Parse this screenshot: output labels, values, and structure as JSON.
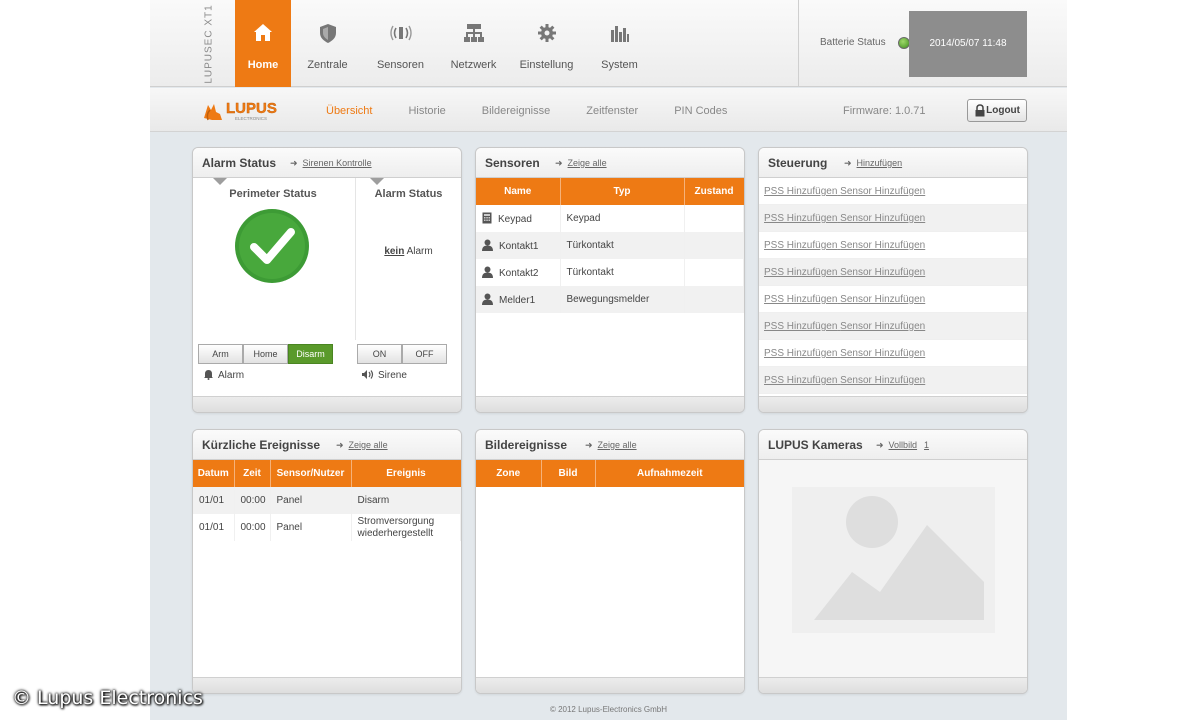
{
  "topbar": {
    "brand": "LUPUSEC XT1",
    "nav": [
      {
        "label": "Home",
        "icon": "home-icon",
        "active": true
      },
      {
        "label": "Zentrale",
        "icon": "shield-icon"
      },
      {
        "label": "Sensoren",
        "icon": "sensor-icon"
      },
      {
        "label": "Netzwerk",
        "icon": "network-icon"
      },
      {
        "label": "Einstellung",
        "icon": "gear-icon"
      },
      {
        "label": "System",
        "icon": "system-icon"
      }
    ],
    "battery_label": "Batterie Status",
    "datetime": "2014/05/07 11:48"
  },
  "subnav": {
    "tabs": [
      "Übersicht",
      "Historie",
      "Bildereignisse",
      "Zeitfenster",
      "PIN Codes"
    ],
    "firmware": "Firmware: 1.0.71",
    "logout": "Logout",
    "logo_text": "LUPUS",
    "logo_sub": "ELECTRONICS"
  },
  "alarm_panel": {
    "title": "Alarm Status",
    "link": "Sirenen Kontrolle",
    "perimeter_title": "Perimeter Status",
    "alarm_status_title": "Alarm Status",
    "kein": "kein",
    "alarm_word": "Alarm",
    "mode_buttons": [
      "Arm",
      "Home",
      "Disarm"
    ],
    "siren_buttons": [
      "ON",
      "OFF"
    ],
    "alarm_label": "Alarm",
    "siren_label": "Sirene"
  },
  "sensors_panel": {
    "title": "Sensoren",
    "link": "Zeige alle",
    "headers": [
      "Name",
      "Typ",
      "Zustand"
    ],
    "rows": [
      {
        "name": "Keypad",
        "typ": "Keypad",
        "zustand": "",
        "icon": "keypad-icon"
      },
      {
        "name": "Kontakt1",
        "typ": "Türkontakt",
        "zustand": "",
        "icon": "person-icon"
      },
      {
        "name": "Kontakt2",
        "typ": "Türkontakt",
        "zustand": "",
        "icon": "person-icon"
      },
      {
        "name": "Melder1",
        "typ": "Bewegungsmelder",
        "zustand": "",
        "icon": "person-icon"
      }
    ]
  },
  "control_panel": {
    "title": "Steuerung",
    "link": "Hinzufügen",
    "row_a": "PSS Hinzufügen",
    "row_b": "Sensor Hinzufügen",
    "row_count_label": "8"
  },
  "events_panel": {
    "title": "Kürzliche Ereignisse",
    "link": "Zeige alle",
    "headers": [
      "Datum",
      "Zeit",
      "Sensor/Nutzer",
      "Ereignis"
    ],
    "rows": [
      {
        "datum": "01/01",
        "zeit": "00:00",
        "sensor": "Panel",
        "ereignis": "Disarm"
      },
      {
        "datum": "01/01",
        "zeit": "00:00",
        "sensor": "Panel",
        "ereignis": "Stromversorgung wiederhergestellt"
      }
    ]
  },
  "image_events_panel": {
    "title": "Bildereignisse",
    "link": "Zeige alle",
    "headers": [
      "Zone",
      "Bild",
      "Aufnahmezeit"
    ]
  },
  "cameras_panel": {
    "title": "LUPUS Kameras",
    "link": "Vollbild",
    "link2": "1"
  },
  "footer": {
    "copyright": "© 2012 Lupus-Electronics GmbH",
    "watermark": "© Lupus Electronics"
  },
  "colors": {
    "accent": "#ee7a14",
    "status_green": "#5a9a2b"
  }
}
